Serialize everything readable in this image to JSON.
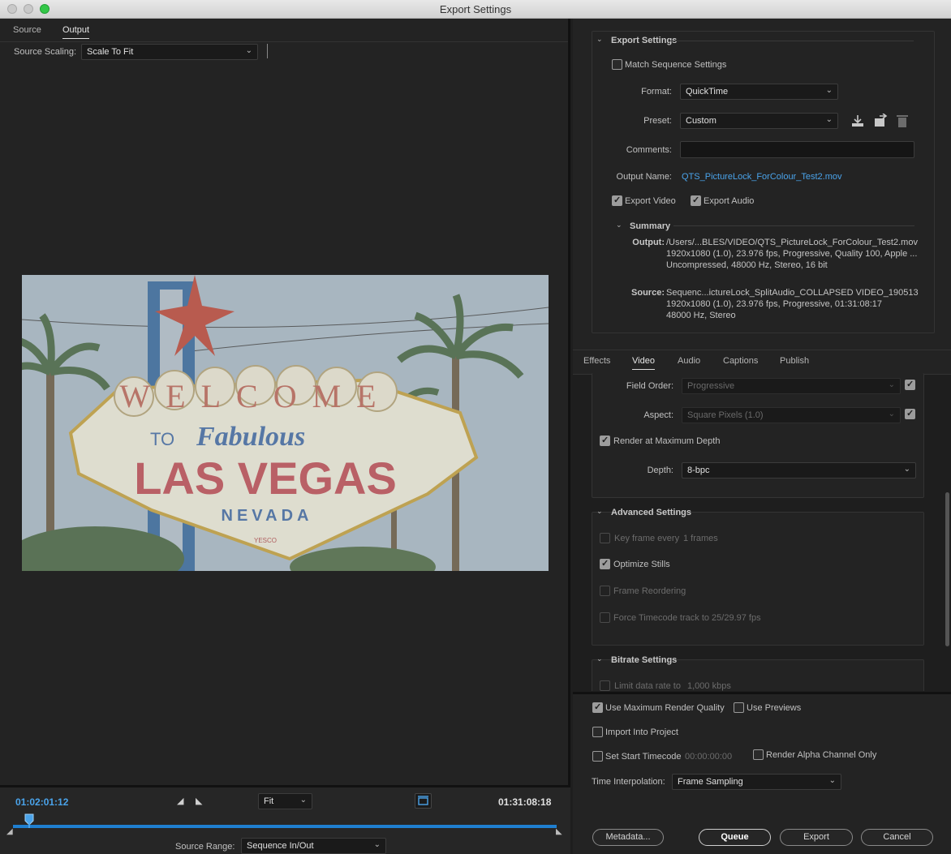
{
  "window": {
    "title": "Export Settings"
  },
  "left_tabs": [
    "Source",
    "Output"
  ],
  "source_scaling": {
    "label": "Source Scaling:",
    "value": "Scale To Fit"
  },
  "preview": {
    "sign_welcome": "WELCOME",
    "sign_to": "TO",
    "sign_fabulous": "Fabulous",
    "sign_las_vegas": "LAS VEGAS",
    "sign_nevada": "NEVADA",
    "sign_yesco": "YESCO"
  },
  "timeline": {
    "current_tc": "01:02:01:12",
    "duration_tc": "01:31:08:18",
    "zoom": "Fit",
    "source_range_label": "Source Range:",
    "source_range_value": "Sequence In/Out",
    "playhead_fraction": 0.03
  },
  "export_settings": {
    "header": "Export Settings",
    "match_sequence": "Match Sequence Settings",
    "format_label": "Format:",
    "format_value": "QuickTime",
    "preset_label": "Preset:",
    "preset_value": "Custom",
    "comments_label": "Comments:",
    "output_name_label": "Output Name:",
    "output_name_value": "QTS_PictureLock_ForColour_Test2.mov",
    "export_video": "Export Video",
    "export_audio": "Export Audio",
    "summary_header": "Summary",
    "output_label": "Output:",
    "output_lines": [
      "/Users/...BLES/VIDEO/QTS_PictureLock_ForColour_Test2.mov",
      "1920x1080 (1.0), 23.976 fps, Progressive, Quality 100, Apple ...",
      "Uncompressed, 48000 Hz, Stereo, 16 bit"
    ],
    "source_label": "Source:",
    "source_lines": [
      "Sequenc...ictureLock_SplitAudio_COLLAPSED VIDEO_190513",
      "1920x1080 (1.0), 23.976 fps, Progressive, 01:31:08:17",
      "48000 Hz, Stereo"
    ]
  },
  "settings_tabs": [
    "Effects",
    "Video",
    "Audio",
    "Captions",
    "Publish"
  ],
  "video": {
    "field_order_label": "Field Order:",
    "field_order_value": "Progressive",
    "aspect_label": "Aspect:",
    "aspect_value": "Square Pixels (1.0)",
    "render_max_depth": "Render at Maximum Depth",
    "depth_label": "Depth:",
    "depth_value": "8-bpc"
  },
  "advanced": {
    "header": "Advanced Settings",
    "key_frame_prefix": "Key frame every",
    "key_frame_value": "1 frames",
    "optimize_stills": "Optimize Stills",
    "frame_reordering": "Frame Reordering",
    "force_timecode": "Force Timecode track to 25/29.97 fps"
  },
  "bitrate": {
    "header": "Bitrate Settings",
    "limit_label": "Limit data rate to",
    "limit_value": "1,000 kbps"
  },
  "bottom": {
    "use_max_quality": "Use Maximum Render Quality",
    "use_previews": "Use Previews",
    "import_into_project": "Import Into Project",
    "set_start_tc": "Set Start Timecode",
    "start_tc_value": "00:00:00:00",
    "render_alpha": "Render Alpha Channel Only",
    "time_interp_label": "Time Interpolation:",
    "time_interp_value": "Frame Sampling",
    "metadata_btn": "Metadata...",
    "queue_btn": "Queue",
    "export_btn": "Export",
    "cancel_btn": "Cancel"
  },
  "colors": {
    "accent": "#4aa3ea",
    "timeline_bar": "#1f7fd0"
  }
}
